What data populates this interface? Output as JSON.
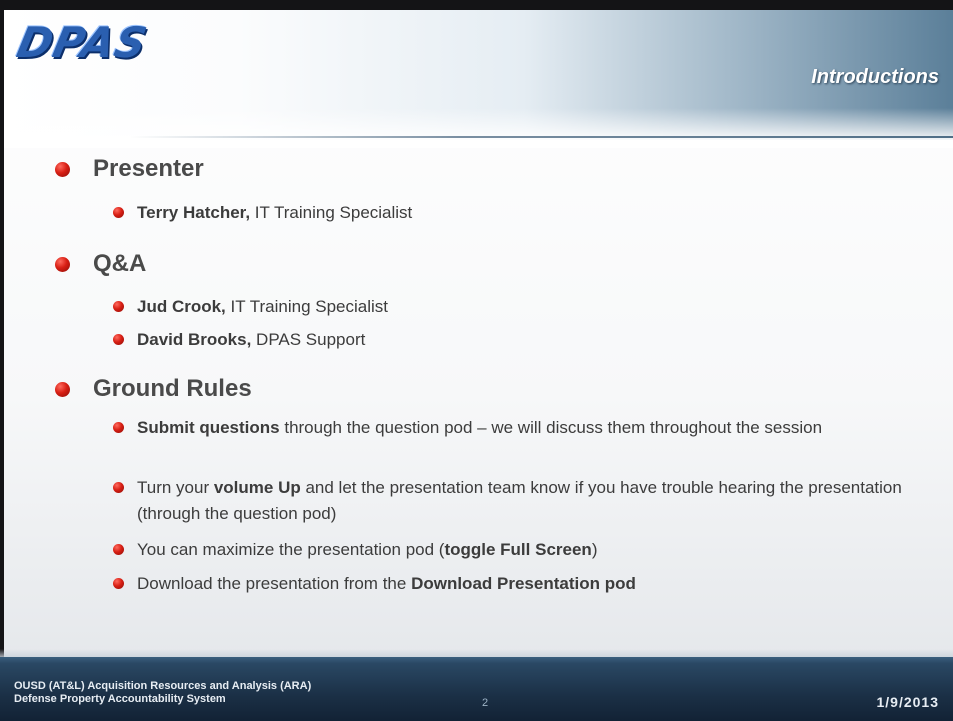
{
  "header": {
    "logo_text": "DPAS",
    "section_title": "Introductions"
  },
  "sections": [
    {
      "title": "Presenter",
      "items": [
        {
          "bold": "Terry Hatcher,",
          "text": " IT Training Specialist"
        }
      ]
    },
    {
      "title": "Q&A",
      "items": [
        {
          "bold": "Jud Crook,",
          "text": " IT Training Specialist"
        },
        {
          "bold": "David Brooks,",
          "text": " DPAS Support"
        }
      ]
    },
    {
      "title": "Ground Rules",
      "items": [
        {
          "pre": "",
          "bold": "Submit questions",
          "post": " through the question pod – we will discuss them throughout the session"
        },
        {
          "pre": "Turn your ",
          "bold": "volume Up",
          "post": " and let the presentation team know if you have trouble hearing the presentation (through the question pod)"
        },
        {
          "pre": "You can maximize the presentation pod (",
          "bold": "toggle Full Screen",
          "post": ")"
        },
        {
          "pre": "Download the presentation from the ",
          "bold": "Download Presentation pod",
          "post": ""
        }
      ]
    }
  ],
  "footer": {
    "org_line1": "OUSD (AT&L) Acquisition Resources and Analysis (ARA)",
    "org_line2": "Defense Property Accountability System",
    "page_number": "2",
    "date": "1/9/2013"
  },
  "colors": {
    "bullet": "#d81f14",
    "logo": "#2a5fb0",
    "footer_bg": "#1b3046"
  }
}
